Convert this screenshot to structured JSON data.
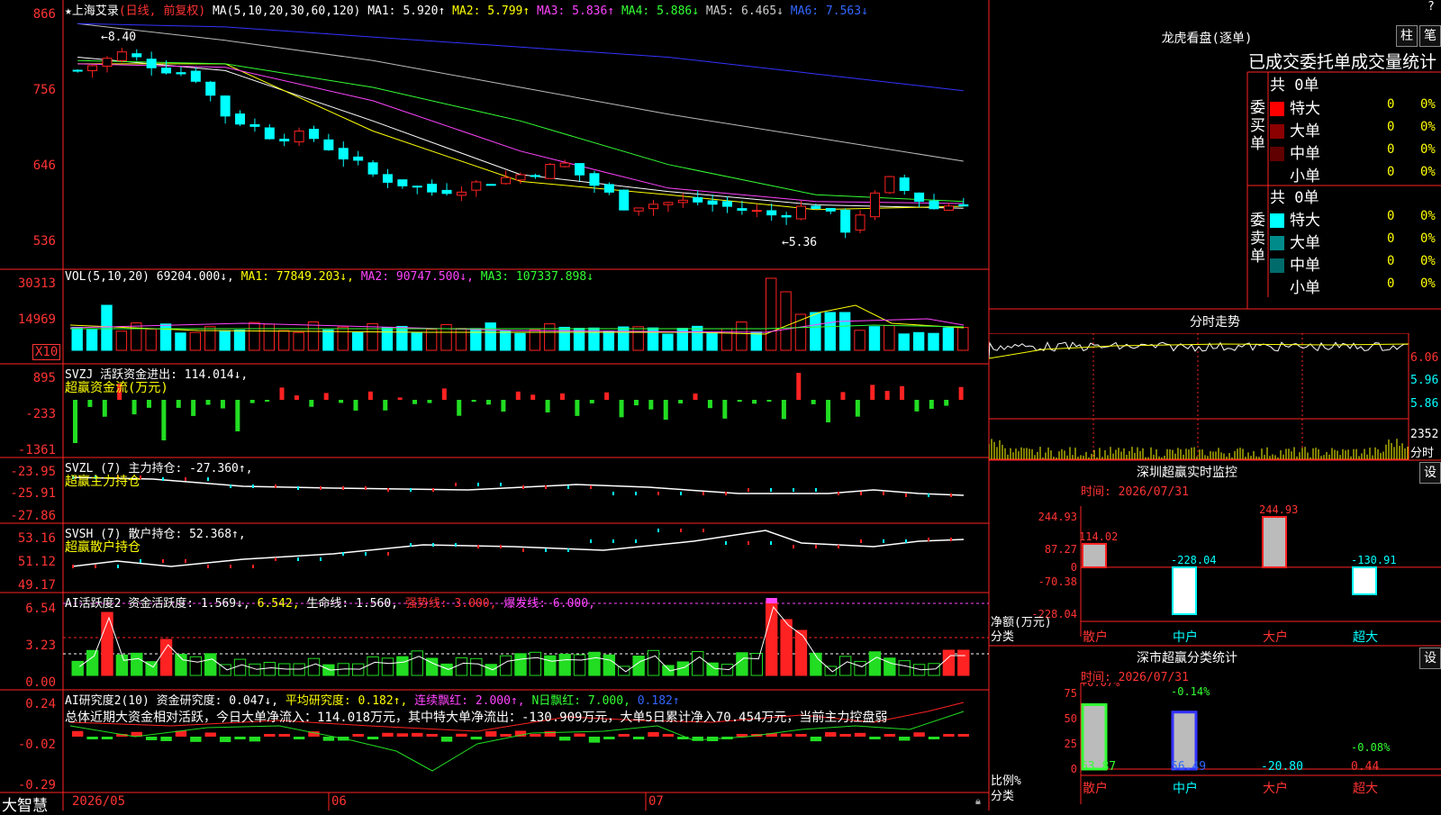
{
  "app": {
    "brand": "大智慧"
  },
  "main_chart": {
    "star": "★",
    "stock_name": "上海艾录",
    "mode": "(日线, 前复权)",
    "ma_label": "MA(5,10,20,30,60,120)",
    "ma1": "MA1: 5.920↑",
    "ma2": "MA2: 5.799↑",
    "ma3": "MA3: 5.836↑",
    "ma4": "MA4: 5.886↓",
    "ma5": "MA5: 6.465↓",
    "ma6": "MA6: 7.563↓",
    "y_labels": [
      "866",
      "756",
      "646",
      "536"
    ],
    "high_note": "←8.40",
    "low_note": "←5.36",
    "corner": "?"
  },
  "vol_panel": {
    "title": "VOL(5,10,20)",
    "v1": "69204.000↓,",
    "ma1": "MA1: 77849.203↓,",
    "ma2": "MA2: 90747.500↓,",
    "ma3": "MA3: 107337.898↓",
    "y_labels": [
      "30313",
      "14969"
    ],
    "unit": "X10"
  },
  "svzj_panel": {
    "title": "SVZJ  活跃资金进出: 114.014↓,",
    "subtitle": "超赢资金流(万元)",
    "y_labels": [
      "895",
      "-233",
      "-1361"
    ]
  },
  "svzl_panel": {
    "title": "SVZL (7) 主力持仓: -27.360↑,",
    "subtitle": "超赢主力持仓",
    "y_labels": [
      "-23.95",
      "-25.91",
      "-27.86"
    ]
  },
  "svsh_panel": {
    "title": "SVSH (7) 散户持仓: 52.368↑,",
    "subtitle": "超赢散户持仓",
    "y_labels": [
      "53.16",
      "51.12",
      "49.17"
    ]
  },
  "ai_active_panel": {
    "title_a": "AI活跃度2 资金活跃度: 1.569↓,",
    "title_b": "6.542,",
    "title_c": "生命线: 1.560,",
    "title_d": "强势线: 3.000,",
    "title_e": "爆发线: 6.000,",
    "y_labels": [
      "6.54",
      "3.23",
      "0.00"
    ]
  },
  "ai_research_panel": {
    "title_a": "AI研究度2(10) 资金研究度: 0.047↓,",
    "title_b": "平均研究度: 0.182↑,",
    "title_c": "连续飘红: 2.000↑,",
    "title_d": "N日飘红: 7.000,",
    "title_e": "0.182↑",
    "summary": "总体近期大资金相对活跃，今日大单净流入：114.018万元，其中特大单净流出：-130.909万元，大单5日累计净入70.454万元，当前主力控盘弱",
    "y_labels": [
      "0.24",
      "-0.02",
      "-0.29"
    ]
  },
  "x_axis": {
    "labels": [
      "2026/05",
      "06",
      "07"
    ]
  },
  "right": {
    "dragon": {
      "title": "龙虎看盘(逐单)",
      "btn_bar": "柱",
      "btn_pen": "笔",
      "header": "已成交委托单成交量统计",
      "buy_total": "共 0单",
      "buy_side": "委买单",
      "sell_total": "共 0单",
      "sell_side": "委卖单",
      "rows": [
        {
          "label": "特大",
          "count": "0",
          "pct": "0%",
          "color": "#ff0000"
        },
        {
          "label": "大单",
          "count": "0",
          "pct": "0%",
          "color": "#8b0000"
        },
        {
          "label": "中单",
          "count": "0",
          "pct": "0%",
          "color": "#600000"
        },
        {
          "label": "小单",
          "count": "0",
          "pct": "0%",
          "color": "#000000"
        }
      ],
      "sell_rows": [
        {
          "label": "特大",
          "count": "0",
          "pct": "0%",
          "color": "#00ffff"
        },
        {
          "label": "大单",
          "count": "0",
          "pct": "0%",
          "color": "#008b8b"
        },
        {
          "label": "中单",
          "count": "0",
          "pct": "0%",
          "color": "#006b6b"
        },
        {
          "label": "小单",
          "count": "0",
          "pct": "0%",
          "color": "#000000"
        }
      ]
    },
    "intraday": {
      "title": "分时走势",
      "y_labels": [
        "6.06",
        "5.96",
        "5.86"
      ],
      "vol_label": "2352",
      "vol_unit": "分时"
    },
    "monitor": {
      "title": "深圳超赢实时监控",
      "btn": "设",
      "time": "时间: 2026/07/31",
      "y_labels": [
        "244.93",
        "87.27",
        "0",
        "-70.38",
        "-228.04"
      ],
      "unit_a": "净额(万元)",
      "unit_b": "分类",
      "categories": [
        "散户",
        "中户",
        "大户",
        "超大"
      ],
      "values": [
        114.02,
        -228.04,
        244.93,
        -130.91
      ],
      "value_labels": [
        "114.02",
        "-228.04",
        "244.93",
        "-130.91"
      ]
    },
    "classify": {
      "title": "深市超赢分类统计",
      "btn": "设",
      "time": "时间: 2026/07/31",
      "y_labels": [
        "75",
        "50",
        "25",
        "0"
      ],
      "unit_a": "比例%",
      "unit_b": "分类",
      "categories": [
        "散户",
        "中户",
        "大户",
        "超大"
      ],
      "top_labels": [
        "+0.07%",
        "-0.14%",
        "",
        "-0.08%"
      ],
      "values": [
        63.87,
        56.49,
        -20.8,
        0.44
      ],
      "value_labels": [
        "63.87",
        "56.49",
        "-20.80",
        "0.44"
      ]
    }
  },
  "chart_data": [
    {
      "type": "candlestick",
      "title": "上海艾录(日线, 前复权)",
      "ylim": [
        5.36,
        8.66
      ],
      "y_ticks": [
        8.66,
        7.56,
        6.46,
        5.36
      ],
      "annotations": [
        "←8.40",
        "←5.36"
      ]
    },
    {
      "type": "bar",
      "title": "VOL(5,10,20)",
      "y_ticks": [
        30313,
        14969
      ]
    },
    {
      "type": "bar",
      "title": "超赢资金流(万元)",
      "y_ticks": [
        895,
        -233,
        -1361
      ]
    },
    {
      "type": "line",
      "title": "超赢主力持仓",
      "y_ticks": [
        -23.95,
        -25.91,
        -27.86
      ]
    },
    {
      "type": "line",
      "title": "超赢散户持仓",
      "y_ticks": [
        53.16,
        51.12,
        49.17
      ]
    },
    {
      "type": "bar",
      "title": "AI活跃度2",
      "y_ticks": [
        6.54,
        3.23,
        0.0
      ]
    },
    {
      "type": "bar",
      "title": "AI研究度2(10)",
      "y_ticks": [
        0.24,
        -0.02,
        -0.29
      ]
    },
    {
      "type": "bar",
      "title": "深圳超赢实时监控",
      "categories": [
        "散户",
        "中户",
        "大户",
        "超大"
      ],
      "values": [
        114.02,
        -228.04,
        244.93,
        -130.91
      ],
      "y_ticks": [
        244.93,
        87.27,
        0,
        -70.38,
        -228.04
      ]
    },
    {
      "type": "bar",
      "title": "深市超赢分类统计",
      "categories": [
        "散户",
        "中户",
        "大户",
        "超大"
      ],
      "values": [
        63.87,
        56.49,
        -20.8,
        0.44
      ],
      "y_ticks": [
        75,
        50,
        25,
        0
      ]
    }
  ]
}
